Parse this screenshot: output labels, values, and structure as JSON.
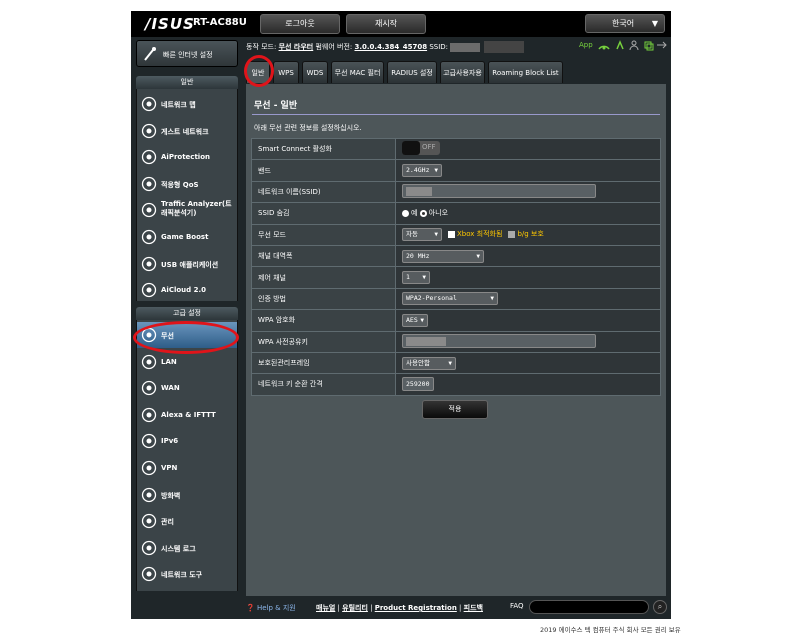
{
  "header": {
    "logo": "/ISUS",
    "model": "RT-AC88U",
    "logout": "로그아웃",
    "reboot": "재시작",
    "language": "한국어"
  },
  "quick_setup": "빠른 인터넷 설정",
  "status": {
    "mode_label": "동작 모드:",
    "mode_value": "무선 라우터",
    "fw_label": "펌웨어 버전:",
    "fw_value": "3.0.0.4.384_45708",
    "ssid_label": "SSID:",
    "app_label": "App"
  },
  "sidebar": {
    "general_title": "일반",
    "general_items": [
      {
        "label": "네트워크 맵",
        "icon": "globe-icon"
      },
      {
        "label": "게스트 네트워크",
        "icon": "guest-network-icon"
      },
      {
        "label": "AiProtection",
        "icon": "shield-icon"
      },
      {
        "label": "적응형 QoS",
        "icon": "speedometer-icon"
      },
      {
        "label": "Traffic Analyzer(트래픽분석기)",
        "icon": "chart-icon"
      },
      {
        "label": "Game Boost",
        "icon": "gamepad-icon"
      },
      {
        "label": "USB 애플리케이션",
        "icon": "usb-icon"
      },
      {
        "label": "AiCloud 2.0",
        "icon": "cloud-icon"
      }
    ],
    "advanced_title": "고급 설정",
    "advanced_items": [
      {
        "label": "무선",
        "icon": "wifi-icon"
      },
      {
        "label": "LAN",
        "icon": "lan-icon"
      },
      {
        "label": "WAN",
        "icon": "wan-globe-icon"
      },
      {
        "label": "Alexa & IFTTT",
        "icon": "alexa-icon"
      },
      {
        "label": "IPv6",
        "icon": "ipv6-icon"
      },
      {
        "label": "VPN",
        "icon": "vpn-icon"
      },
      {
        "label": "방화벽",
        "icon": "firewall-icon"
      },
      {
        "label": "관리",
        "icon": "gear-icon"
      },
      {
        "label": "시스템 로그",
        "icon": "log-icon"
      },
      {
        "label": "네트워크 도구",
        "icon": "tools-icon"
      }
    ]
  },
  "tabs": [
    "일반",
    "WPS",
    "WDS",
    "무선 MAC 필터",
    "RADIUS 설정",
    "고급사용자용",
    "Roaming Block List"
  ],
  "panel": {
    "title": "무선 - 일반",
    "description": "아래 무선 관련 정보를 설정하십시오.",
    "rows": {
      "smart_connect": {
        "label": "Smart Connect 활성화",
        "value": "OFF"
      },
      "band": {
        "label": "밴드",
        "value": "2.4GHz"
      },
      "ssid": {
        "label": "네트워크 이름(SSID)"
      },
      "hide_ssid": {
        "label": "SSID 숨김",
        "yes": "예",
        "no": "아니오"
      },
      "wireless_mode": {
        "label": "무선 모드",
        "value": "자동",
        "xbox": "Xbox 최적화됨",
        "bg": "b/g 보호"
      },
      "channel_bandwidth": {
        "label": "채널 대역폭",
        "value": "20 MHz"
      },
      "control_channel": {
        "label": "제어 채널",
        "value": "1"
      },
      "auth_method": {
        "label": "인증 방법",
        "value": "WPA2-Personal"
      },
      "wpa_encryption": {
        "label": "WPA 암호화",
        "value": "AES"
      },
      "wpa_key": {
        "label": "WPA 사전공유키"
      },
      "pmf": {
        "label": "보호된관리프레임",
        "value": "사용안함"
      },
      "key_rotation": {
        "label": "네트워크 키 순환 간격",
        "value": "259200"
      }
    },
    "apply": "적용"
  },
  "footer": {
    "help": "Help & 지원",
    "manual": "매뉴얼",
    "utility": "유틸리티",
    "registration": "Product Registration",
    "feedback": "피드백",
    "faq": "FAQ"
  },
  "copyright": "2019 에이수스 텍 컴퓨터 주식 회사 모든 권리 보유"
}
